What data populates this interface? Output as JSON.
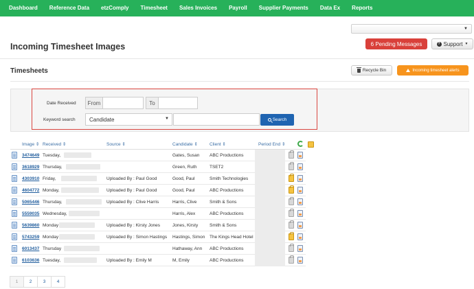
{
  "nav": [
    "Dashboard",
    "Reference Data",
    "etzComply",
    "Timesheet",
    "Sales Invoices",
    "Payroll",
    "Supplier Payments",
    "Data Ex",
    "Reports"
  ],
  "page_title": "Incoming Timesheet Images",
  "buttons": {
    "pending": "6 Pending Messages",
    "support": "Support",
    "recycle_bin": "Recycle Bin",
    "alerts": "Incoming timesheet alerts",
    "search": "Search"
  },
  "section_title": "Timesheets",
  "filter": {
    "date_label": "Date Received",
    "from": "From",
    "to": "To",
    "keyword_label": "Keyword search",
    "keyword_select": "Candidate"
  },
  "columns": [
    "Image",
    "Received",
    "Source",
    "Candidate",
    "Client",
    "Period End"
  ],
  "rows": [
    {
      "image": "3474649",
      "received": "Tuesday,",
      "source": "",
      "candidate": "Gates, Susan",
      "client": "ABC Productions",
      "gold": false
    },
    {
      "image": "3618929",
      "received": "Thursday,",
      "source": "",
      "candidate": "Green, Ruth",
      "client": "TSET2",
      "gold": false
    },
    {
      "image": "4303910",
      "received": "Friday,",
      "source": "Uploaded By : Paul Good",
      "candidate": "Good, Paul",
      "client": "Smith Technologies",
      "gold": true
    },
    {
      "image": "4604772",
      "received": "Monday,",
      "source": "Uploaded By : Paul Good",
      "candidate": "Good, Paul",
      "client": "ABC Productions",
      "gold": true
    },
    {
      "image": "5065446",
      "received": "Thursday,",
      "source": "Uploaded By : Clive Harris",
      "candidate": "Harris, Clive",
      "client": "Smith & Sons",
      "gold": false
    },
    {
      "image": "5559035",
      "received": "Wednesday,",
      "source": "",
      "candidate": "Harris, Alex",
      "client": "ABC Productions",
      "gold": false
    },
    {
      "image": "5639860",
      "received": "Monday",
      "source": "Uploaded By : Kirsty Jones",
      "candidate": "Jones, Kirsty",
      "client": "Smith & Sons",
      "gold": false
    },
    {
      "image": "5743259",
      "received": "Monday",
      "source": "Uploaded By : Simon Hastings",
      "candidate": "Hastings, Simon",
      "client": "The Kings Head Hotel",
      "gold": true
    },
    {
      "image": "6013437",
      "received": "Thursday",
      "source": "",
      "candidate": "Hathaway, Ann",
      "client": "ABC Productions",
      "gold": false
    },
    {
      "image": "6103636",
      "received": "Tuesday,",
      "source": "Uploaded By : Emily M",
      "candidate": "M, Emily",
      "client": "ABC Productions",
      "gold": false
    }
  ],
  "pages": [
    "1",
    "2",
    "3",
    "4"
  ]
}
